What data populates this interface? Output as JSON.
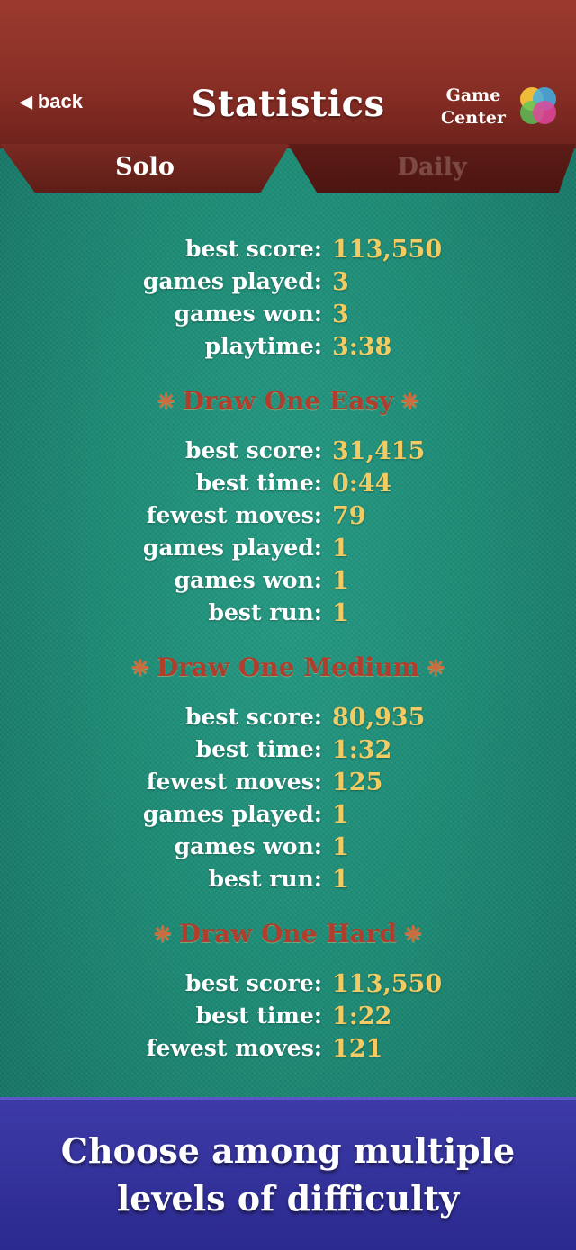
{
  "header": {
    "back_label": "back",
    "title": "Statistics",
    "game_center_line1": "Game",
    "game_center_line2": "Center"
  },
  "tabs": [
    {
      "label": "Solo",
      "active": true
    },
    {
      "label": "Daily",
      "active": false
    }
  ],
  "overall": [
    {
      "label": "best score:",
      "value": "113,550"
    },
    {
      "label": "games played:",
      "value": "3"
    },
    {
      "label": "games won:",
      "value": "3"
    },
    {
      "label": "playtime:",
      "value": "3:38"
    }
  ],
  "sections": [
    {
      "title": "Draw One Easy",
      "rows": [
        {
          "label": "best score:",
          "value": "31,415"
        },
        {
          "label": "best time:",
          "value": "0:44"
        },
        {
          "label": "fewest moves:",
          "value": "79"
        },
        {
          "label": "games played:",
          "value": "1"
        },
        {
          "label": "games won:",
          "value": "1"
        },
        {
          "label": "best run:",
          "value": "1"
        }
      ]
    },
    {
      "title": "Draw One Medium",
      "rows": [
        {
          "label": "best score:",
          "value": "80,935"
        },
        {
          "label": "best time:",
          "value": "1:32"
        },
        {
          "label": "fewest moves:",
          "value": "125"
        },
        {
          "label": "games played:",
          "value": "1"
        },
        {
          "label": "games won:",
          "value": "1"
        },
        {
          "label": "best run:",
          "value": "1"
        }
      ]
    },
    {
      "title": "Draw One Hard",
      "rows": [
        {
          "label": "best score:",
          "value": "113,550"
        },
        {
          "label": "best time:",
          "value": "1:22"
        },
        {
          "label": "fewest moves:",
          "value": "121"
        }
      ]
    }
  ],
  "banner": {
    "line1": "Choose among multiple",
    "line2": "levels of difficulty"
  },
  "colors": {
    "header": "#8a2f26",
    "felt": "#1b8a76",
    "value": "#f2cc63",
    "section_title": "#b13d2c",
    "banner": "#332f9c"
  }
}
